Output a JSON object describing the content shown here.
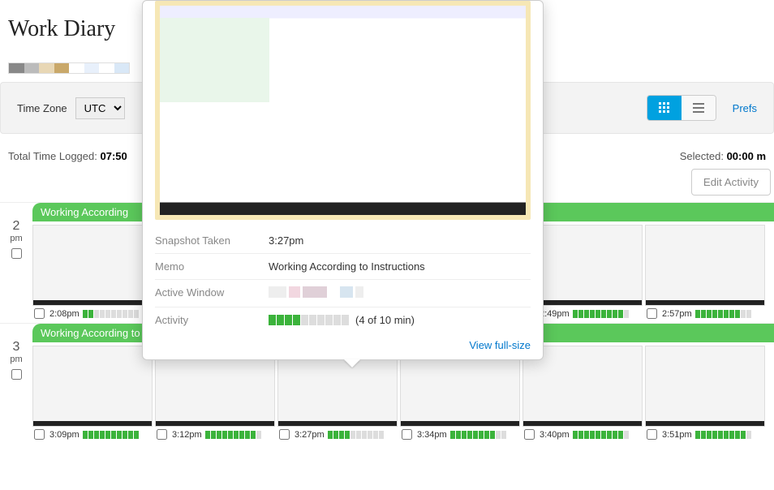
{
  "page": {
    "title": "Work Diary"
  },
  "toolbar": {
    "tz_label": "Time Zone",
    "tz_value": "UTC",
    "prefs_label": "Prefs"
  },
  "stats": {
    "total_label": "Total Time Logged:",
    "total_value": "07:50",
    "selected_label": "Selected:",
    "selected_value": "00:00 m"
  },
  "buttons": {
    "edit_activity": "Edit Activity"
  },
  "popover": {
    "snapshot_label": "Snapshot Taken",
    "snapshot_value": "3:27pm",
    "memo_label": "Memo",
    "memo_value": "Working According to Instructions",
    "active_window_label": "Active Window",
    "activity_label": "Activity",
    "activity_text": "(4 of 10 min)",
    "activity_bars": [
      1,
      1,
      1,
      1,
      0,
      0,
      0,
      0,
      0,
      0
    ],
    "view_full": "View full-size"
  },
  "rows": [
    {
      "hour": "2",
      "ampm": "pm",
      "memo": "Working According",
      "thumbs": [
        {
          "time": "2:08pm",
          "bars": [
            1,
            1,
            0,
            0,
            0,
            0,
            0,
            0,
            0,
            0
          ]
        },
        {
          "time": "",
          "bars": []
        },
        {
          "time": "",
          "bars": []
        },
        {
          "time": "",
          "bars": []
        },
        {
          "time": "2:49pm",
          "bars": [
            1,
            1,
            1,
            1,
            1,
            1,
            1,
            1,
            1,
            0
          ]
        },
        {
          "time": "2:57pm",
          "bars": [
            1,
            1,
            1,
            1,
            1,
            1,
            1,
            1,
            0,
            0
          ]
        }
      ]
    },
    {
      "hour": "3",
      "ampm": "pm",
      "memo": "Working According to Instructions",
      "thumbs": [
        {
          "time": "3:09pm",
          "bars": [
            1,
            1,
            1,
            1,
            1,
            1,
            1,
            1,
            1,
            1
          ]
        },
        {
          "time": "3:12pm",
          "bars": [
            1,
            1,
            1,
            1,
            1,
            1,
            1,
            1,
            1,
            0
          ]
        },
        {
          "time": "3:27pm",
          "bars": [
            1,
            1,
            1,
            1,
            0,
            0,
            0,
            0,
            0,
            0
          ]
        },
        {
          "time": "3:34pm",
          "bars": [
            1,
            1,
            1,
            1,
            1,
            1,
            1,
            1,
            0,
            0
          ]
        },
        {
          "time": "3:40pm",
          "bars": [
            1,
            1,
            1,
            1,
            1,
            1,
            1,
            1,
            1,
            0
          ]
        },
        {
          "time": "3:51pm",
          "bars": [
            1,
            1,
            1,
            1,
            1,
            1,
            1,
            1,
            1,
            0
          ]
        }
      ]
    }
  ]
}
